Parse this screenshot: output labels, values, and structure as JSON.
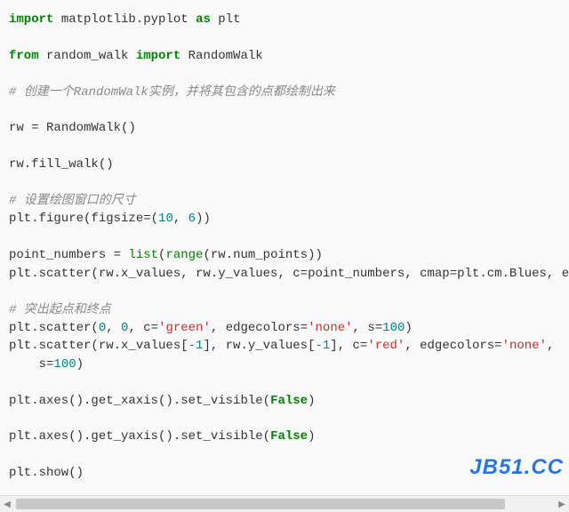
{
  "code": {
    "l01": {
      "kw1": "import",
      "mod1": " matplotlib.pyplot ",
      "kw2": "as",
      "alias": " plt"
    },
    "l03": {
      "kw1": "from",
      "mod1": " random_walk ",
      "kw2": "import",
      "cls": " RandomWalk"
    },
    "l05": "# 创建一个RandomWalk实例，并将其包含的点都绘制出来",
    "l07": {
      "a": "rw ",
      "op": "=",
      "b": " RandomWalk()"
    },
    "l09": "rw.fill_walk()",
    "l11": "# 设置绘图窗口的尺寸",
    "l12": {
      "a": "plt.figure(figsize",
      "op": "=",
      "p1": "(",
      "n1": "10",
      "c": ", ",
      "n2": "6",
      "p2": "))"
    },
    "l14": {
      "a": "point_numbers ",
      "op": "=",
      "sp": " ",
      "bi1": "list",
      "p1": "(",
      "bi2": "range",
      "p2": "(rw.num_points))"
    },
    "l15": {
      "a": "plt.scatter(rw.x_values, rw.y_values, c",
      "op1": "=",
      "b": "point_numbers, cmap",
      "op2": "=",
      "c": "plt.cm.Blues, edgeco"
    },
    "l17": "# 突出起点和终点",
    "l18": {
      "a": "plt.scatter(",
      "n1": "0",
      "c1": ", ",
      "n2": "0",
      "c2": ", c",
      "op1": "=",
      "s1": "'green'",
      "c3": ", edgecolors",
      "op2": "=",
      "s2": "'none'",
      "c4": ", s",
      "op3": "=",
      "n3": "100",
      "c5": ")"
    },
    "l19": {
      "a": "plt.scatter(rw.x_values[",
      "n1": "-1",
      "b": "], rw.y_values[",
      "n2": "-1",
      "c": "], c",
      "op1": "=",
      "s1": "'red'",
      "d": ", edgecolors",
      "op2": "=",
      "s2": "'none'",
      "e": ","
    },
    "l20": {
      "pad": "    s",
      "op": "=",
      "n": "100",
      "p": ")"
    },
    "l22": {
      "a": "plt.axes().get_xaxis().set_visible(",
      "v": "False",
      "b": ")"
    },
    "l24": {
      "a": "plt.axes().get_yaxis().set_visible(",
      "v": "False",
      "b": ")"
    },
    "l26": "plt.show()"
  },
  "watermark": "JB51.CC",
  "scrollbar": {
    "leftGlyph": "◀",
    "rightGlyph": "▶"
  }
}
